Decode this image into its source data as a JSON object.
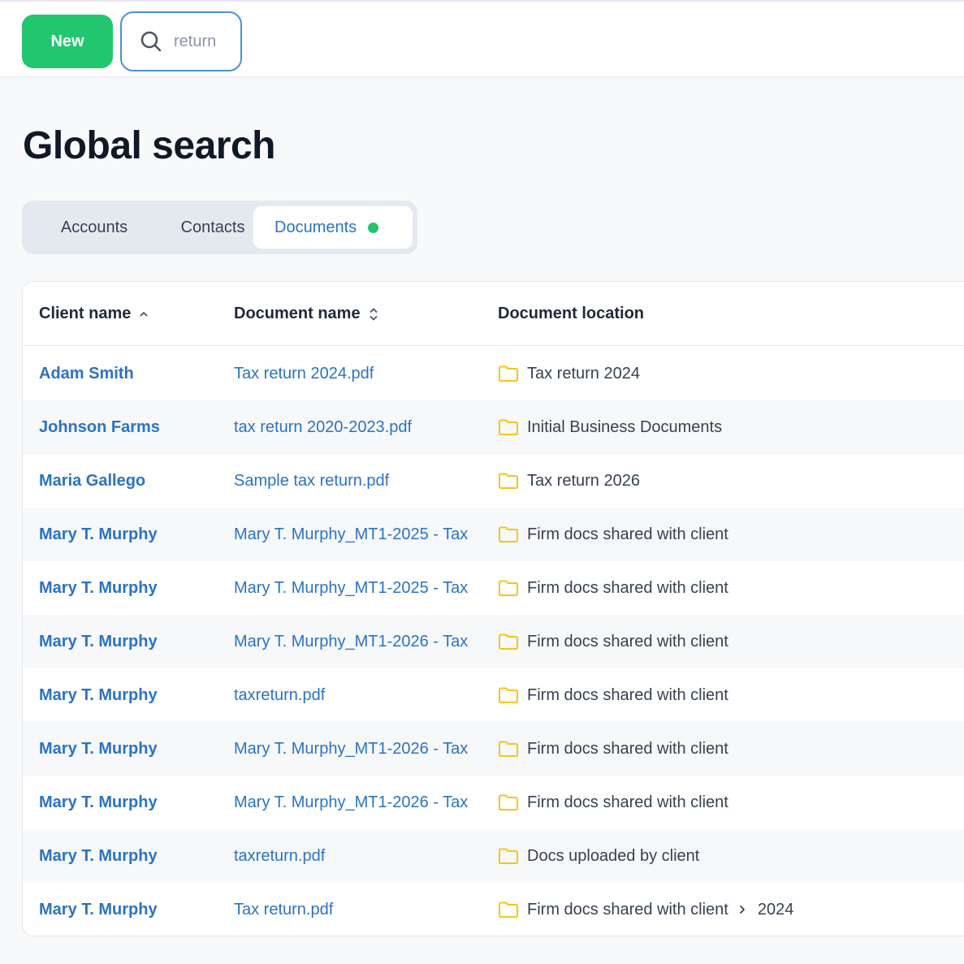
{
  "toolbar": {
    "new_label": "New",
    "search_value": "return",
    "search_icon": "search-icon"
  },
  "page_title": "Global search",
  "tabs": [
    {
      "label": "Accounts",
      "active": false
    },
    {
      "label": "Contacts",
      "active": false
    },
    {
      "label": "Documents",
      "active": true,
      "indicator_color": "#22c66f"
    }
  ],
  "table": {
    "headers": {
      "client": "Client name",
      "document": "Document name",
      "location": "Document location"
    },
    "sort": {
      "client": "ascending",
      "document": "sortable"
    },
    "rows": [
      {
        "client": "Adam Smith",
        "document": "Tax return 2024.pdf",
        "location": "Tax return 2024",
        "sub": ""
      },
      {
        "client": "Johnson Farms",
        "document": "tax return 2020-2023.pdf",
        "location": "Initial Business Documents",
        "sub": ""
      },
      {
        "client": "Maria Gallego",
        "document": "Sample tax return.pdf",
        "location": "Tax return 2026",
        "sub": ""
      },
      {
        "client": "Mary T. Murphy",
        "document": "Mary T. Murphy_MT1-2025 - Tax",
        "location": "Firm docs shared with client",
        "sub": ""
      },
      {
        "client": "Mary T. Murphy",
        "document": "Mary T. Murphy_MT1-2025 - Tax",
        "location": "Firm docs shared with client",
        "sub": ""
      },
      {
        "client": "Mary T. Murphy",
        "document": "Mary T. Murphy_MT1-2026 - Tax",
        "location": "Firm docs shared with client",
        "sub": ""
      },
      {
        "client": "Mary T. Murphy",
        "document": "taxreturn.pdf",
        "location": "Firm docs shared with client",
        "sub": ""
      },
      {
        "client": "Mary T. Murphy",
        "document": "Mary T. Murphy_MT1-2026 - Tax",
        "location": "Firm docs shared with client",
        "sub": ""
      },
      {
        "client": "Mary T. Murphy",
        "document": "Mary T. Murphy_MT1-2026 - Tax",
        "location": "Firm docs shared with client",
        "sub": ""
      },
      {
        "client": "Mary T. Murphy",
        "document": "taxreturn.pdf",
        "location": "Docs uploaded by client",
        "sub": ""
      },
      {
        "client": "Mary T. Murphy",
        "document": "Tax return.pdf",
        "location": "Firm docs shared with client",
        "sub": "2024"
      }
    ]
  },
  "colors": {
    "accent_green": "#22c66f",
    "link_blue": "#2a73c4",
    "folder_yellow": "#f5c518",
    "search_border": "#4a90d9"
  }
}
